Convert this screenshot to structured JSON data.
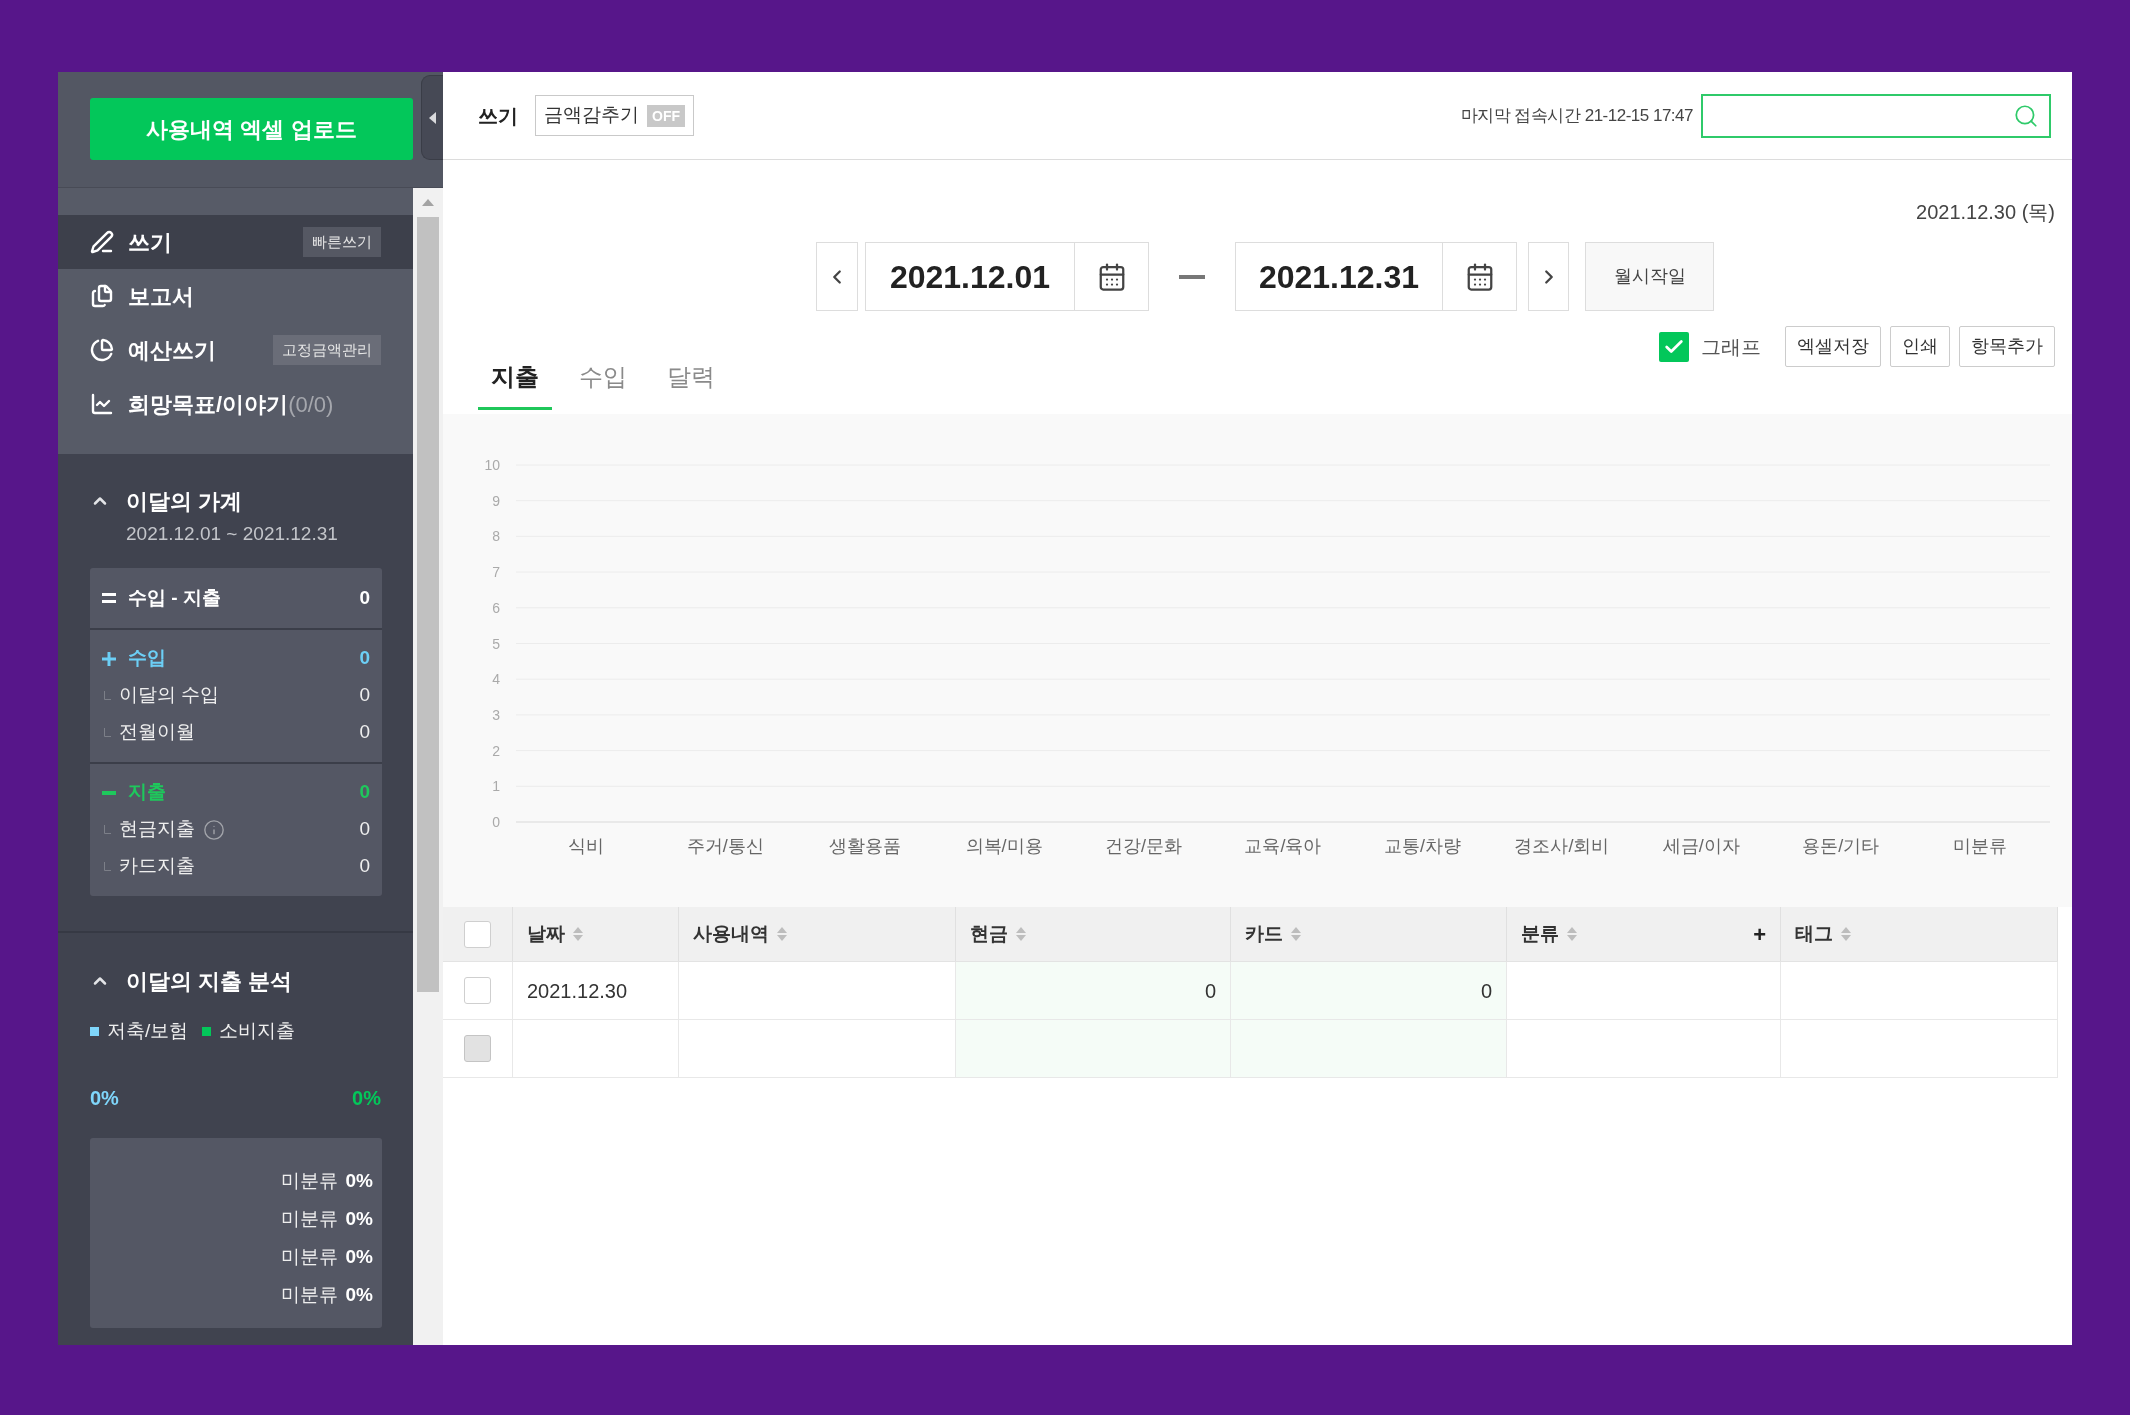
{
  "sidebar": {
    "upload_button": "사용내역 엑셀 업로드",
    "nav_items": [
      {
        "label": "쓰기",
        "selected": true,
        "badge": "빠른쓰기"
      },
      {
        "label": "보고서",
        "selected": false
      },
      {
        "label": "예산쓰기",
        "selected": false,
        "badge": "고정금액관리"
      },
      {
        "label": "희망목표/이야기",
        "count": "(0/0)",
        "selected": false
      }
    ],
    "monthly_budget": {
      "title": "이달의 가계",
      "expanded": true,
      "period": "2021.12.01 ~ 2021.12.31",
      "groups": [
        {
          "kind": "net",
          "label": "수입 - 지출",
          "value": "0",
          "color": "#ffffff"
        },
        {
          "kind": "income",
          "label": "수입",
          "value": "0",
          "color": "#6ccff6",
          "items": [
            {
              "label": "이달의 수입",
              "value": "0",
              "info": false
            },
            {
              "label": "전월이월",
              "value": "0",
              "info": false
            }
          ]
        },
        {
          "kind": "expense",
          "label": "지출",
          "value": "0",
          "color": "#1ec85c",
          "items": [
            {
              "label": "현금지출",
              "value": "0",
              "info": true
            },
            {
              "label": "카드지출",
              "value": "0",
              "info": false
            }
          ]
        }
      ]
    },
    "spending_analysis": {
      "title": "이달의 지출 분석",
      "expanded": true,
      "legend": [
        {
          "label": "저축/보험",
          "color": "#7fd6fb",
          "percent": "0%"
        },
        {
          "label": "소비지출",
          "color": "#03c75a",
          "percent": "0%"
        }
      ],
      "breakdown": [
        {
          "label": "미분류",
          "percent": "0%"
        },
        {
          "label": "미분류",
          "percent": "0%"
        },
        {
          "label": "미분류",
          "percent": "0%"
        },
        {
          "label": "미분류",
          "percent": "0%"
        }
      ]
    }
  },
  "header": {
    "title": "쓰기",
    "hide_amounts": {
      "label": "금액감추기",
      "on": false,
      "state": "OFF"
    },
    "last_access": "마지막 접속시간 21-12-15 17:47"
  },
  "today": "2021.12.30 (목)",
  "date_range": {
    "start": "2021.12.01",
    "end": "2021.12.31",
    "month_start_button": "월시작일"
  },
  "tabs": [
    {
      "label": "지출",
      "selected": true
    },
    {
      "label": "수입",
      "selected": false
    },
    {
      "label": "달력",
      "selected": false
    }
  ],
  "graph_toggle": {
    "label": "그래프",
    "checked": true
  },
  "actions": [
    "엑셀저장",
    "인쇄",
    "항목추가"
  ],
  "chart": {
    "chart_data": {
      "type": "bar",
      "categories": [
        "식비",
        "주거/통신",
        "생활용품",
        "의복/미용",
        "건강/문화",
        "교육/육아",
        "교통/차량",
        "경조사/회비",
        "세금/이자",
        "용돈/기타",
        "미분류"
      ],
      "values": [
        0,
        0,
        0,
        0,
        0,
        0,
        0,
        0,
        0,
        0,
        0
      ],
      "ylim": [
        0,
        10
      ],
      "yticks": [
        0,
        1,
        2,
        3,
        4,
        5,
        6,
        7,
        8,
        9,
        10
      ],
      "grid": true
    }
  },
  "table": {
    "select_all": {
      "checked": false
    },
    "columns": [
      {
        "label": "날짜",
        "kind": "text"
      },
      {
        "label": "사용내역",
        "kind": "text"
      },
      {
        "label": "현금",
        "kind": "amount"
      },
      {
        "label": "카드",
        "kind": "amount"
      },
      {
        "label": "분류",
        "kind": "text",
        "add": "+"
      },
      {
        "label": "태그",
        "kind": "text"
      }
    ],
    "rows": [
      {
        "checked": false,
        "disabled": false,
        "date": "2021.12.30",
        "cash": "0",
        "card": "0"
      },
      {
        "checked": false,
        "disabled": true
      }
    ]
  }
}
